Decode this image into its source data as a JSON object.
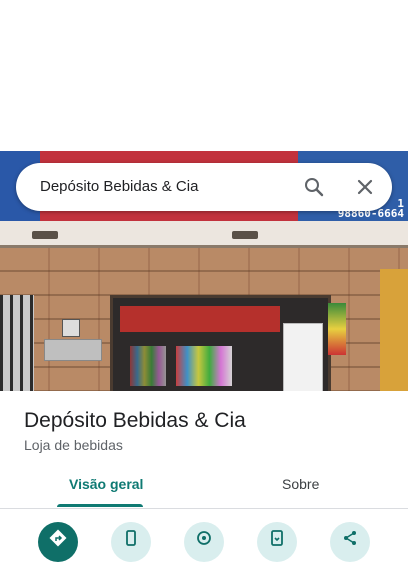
{
  "search": {
    "query": "Depósito Bebidas & Cia"
  },
  "photo": {
    "sign_phone_line1": "1",
    "sign_phone_line2": "98860-6664"
  },
  "place": {
    "name": "Depósito Bebidas & Cia",
    "category": "Loja de bebidas"
  },
  "tabs": [
    {
      "label": "Visão geral",
      "active": true
    },
    {
      "label": "Sobre",
      "active": false
    }
  ],
  "actions": [
    {
      "icon": "directions-icon",
      "primary": true
    },
    {
      "icon": "phone-icon",
      "primary": false
    },
    {
      "icon": "location-pin-icon",
      "primary": false
    },
    {
      "icon": "save-to-phone-icon",
      "primary": false
    },
    {
      "icon": "share-icon",
      "primary": false
    }
  ],
  "colors": {
    "accent": "#0f7a73",
    "action_primary": "#0f6f68",
    "action_secondary": "#d9eeee"
  }
}
